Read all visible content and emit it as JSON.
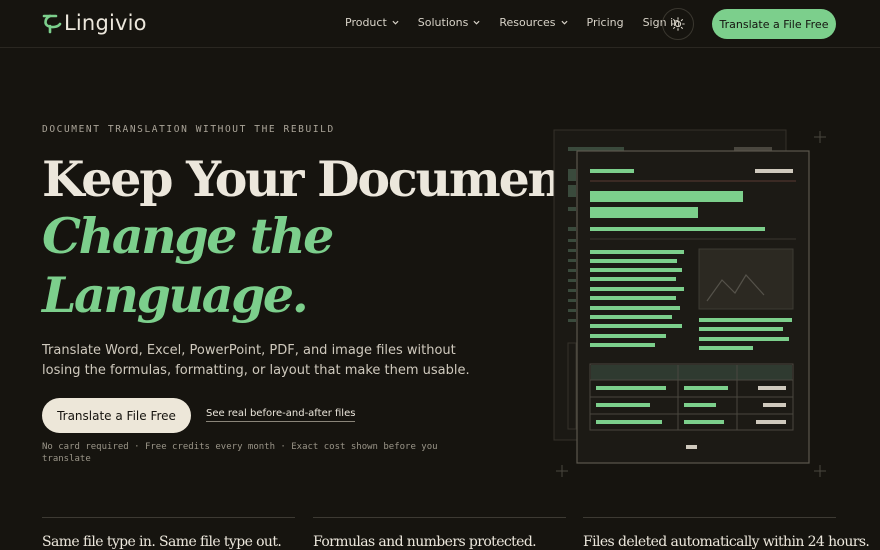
{
  "nav": {
    "logo_text": "Lingivio",
    "items": [
      {
        "label": "Product",
        "has_dropdown": true
      },
      {
        "label": "Solutions",
        "has_dropdown": true
      },
      {
        "label": "Resources",
        "has_dropdown": true
      },
      {
        "label": "Pricing",
        "has_dropdown": false
      },
      {
        "label": "Sign in",
        "has_dropdown": false
      }
    ],
    "theme_toggle_icon": "sun-icon",
    "cta_label": "Translate a File Free"
  },
  "hero": {
    "eyebrow": "DOCUMENT TRANSLATION WITHOUT THE REBUILD",
    "headline_line1": "Keep Your Document.",
    "headline_line2": "Change the",
    "headline_line3": "Language.",
    "lede": "Translate Word, Excel, PowerPoint, PDF, and image files without losing the formulas, formatting, or layout that make them usable.",
    "primary_cta": "Translate a File Free",
    "secondary_link": "See real before-and-after files",
    "fineprint": "No card required · Free credits every month · Exact cost shown before you translate"
  },
  "features": [
    {
      "title": "Same file type in. Same file type out."
    },
    {
      "title": "Formulas and numbers protected."
    },
    {
      "title": "Files deleted automatically within 24 hours."
    }
  ],
  "colors": {
    "background": "#16140f",
    "accent": "#7ccf8c",
    "text": "#ece7dc",
    "cta_light": "#ede7d9"
  }
}
